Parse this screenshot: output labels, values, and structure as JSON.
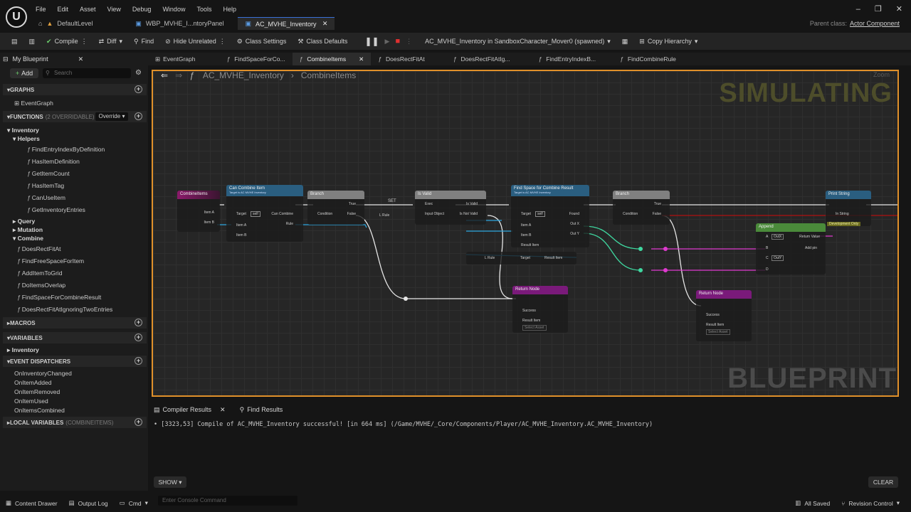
{
  "menu": [
    "File",
    "Edit",
    "Asset",
    "View",
    "Debug",
    "Window",
    "Tools",
    "Help"
  ],
  "doc_tabs": [
    "DefaultLevel",
    "WBP_MVHE_I...ntoryPanel",
    "AC_MVHE_Inventory"
  ],
  "parent_class": {
    "label": "Parent class:",
    "value": "Actor Component"
  },
  "toolbar": {
    "compile": "Compile",
    "diff": "Diff",
    "find": "Find",
    "hide_unrelated": "Hide Unrelated",
    "class_settings": "Class Settings",
    "class_defaults": "Class Defaults",
    "debug_object": "AC_MVHE_Inventory in SandboxCharacter_Mover0 (spawned)",
    "copy_hierarchy": "Copy Hierarchy"
  },
  "my_blueprint": {
    "tab": "My Blueprint",
    "add": "Add",
    "search_placeholder": "Search",
    "graphs_header": "GRAPHS",
    "event_graph": "EventGraph",
    "functions_header": "FUNCTIONS",
    "functions_sub": "(2 OVERRIDABLE)",
    "override": "Override",
    "inventory": "Inventory",
    "helpers": "Helpers",
    "helper_items": [
      "FindEntryIndexByDefinition",
      "HasItemDefinition",
      "GetItemCount",
      "HasItemTag",
      "CanUseItem",
      "GetInventoryEntries"
    ],
    "query": "Query",
    "mutation": "Mutation",
    "combine": "Combine",
    "combine_items": [
      "DoesRectFitAt",
      "FindFreeSpaceForItem",
      "AddItemToGrid",
      "DoItemsOverlap",
      "FindSpaceForCombineResult",
      "DoesRectFitAtIgnoringTwoEntries"
    ],
    "macros_header": "MACROS",
    "variables_header": "VARIABLES",
    "var_inventory": "Inventory",
    "dispatchers_header": "EVENT DISPATCHERS",
    "dispatchers": [
      "OnInventoryChanged",
      "OnItemAdded",
      "OnItemRemoved",
      "OnItemUsed",
      "OnItemsCombined"
    ],
    "locals_header": "LOCAL VARIABLES",
    "locals_sub": "(COMBINEITEMS)"
  },
  "graph_tabs": [
    "EventGraph",
    "FindSpaceForCo...",
    "CombineItems",
    "DoesRectFitAt",
    "DoesRectFitAtIg...",
    "FindEntryIndexB...",
    "FindCombineRule"
  ],
  "breadcrumb": {
    "root": "AC_MVHE_Inventory",
    "sep": "›",
    "current": "CombineItems"
  },
  "zoom": "Zoom",
  "watermarks": {
    "simulating": "SIMULATING",
    "blueprint": "BLUEPRINT"
  },
  "nodes": {
    "combine_items": "CombineItems",
    "can_combine": "Can Combine Item",
    "can_combine_sub": "Target is AC MVHE Inventory",
    "branch1": "Branch",
    "set": "SET",
    "is_valid": "Is Valid",
    "find_space": "Find Space for Combine Result",
    "find_space_sub": "Target is AC MVHE Inventory",
    "branch2": "Branch",
    "append": "Append",
    "print_string": "Print String",
    "dev_only": "Development Only",
    "return1": "Return Node",
    "return2": "Return Node",
    "pins": {
      "item_a": "Item A",
      "item_b": "Item B",
      "target": "Target",
      "self": "self",
      "can_combine": "Can Combine",
      "rule": "Rule",
      "condition": "Condition",
      "true": "True",
      "false": "False",
      "l_rule": "L Rule",
      "exec": "Exec",
      "input_object": "Input Object",
      "is_valid": "Is Valid",
      "is_not_valid": "Is Not Valid",
      "found": "Found",
      "out_x": "Out X",
      "out_y": "Out Y",
      "result_item": "Result Item",
      "success": "Success",
      "in_string": "In String",
      "return_value": "Return Value",
      "add_pin": "Add pin",
      "a": "A",
      "b": "B",
      "c": "C",
      "d": "D",
      "outx": "OutX",
      "outy": "OutY",
      "select_asset": "Select Asset"
    }
  },
  "bottom_tabs": [
    "Compiler Results",
    "Find Results"
  ],
  "log_line": "[3323,53] Compile of AC_MVHE_Inventory successful! [in 664 ms] (/Game/MVHE/_Core/Components/Player/AC_MVHE_Inventory.AC_MVHE_Inventory)",
  "show": "SHOW",
  "clear": "CLEAR",
  "status": {
    "content_drawer": "Content Drawer",
    "output_log": "Output Log",
    "cmd": "Cmd",
    "console_placeholder": "Enter Console Command",
    "all_saved": "All Saved",
    "revision_control": "Revision Control"
  },
  "colors": {
    "accent": "#e0902a",
    "exec_wire": "#e6e6e6",
    "blue_wire": "#2ca7e0",
    "green_wire": "#3fd8a0",
    "pink_wire": "#e03ad0",
    "red_wire": "#b01010"
  }
}
